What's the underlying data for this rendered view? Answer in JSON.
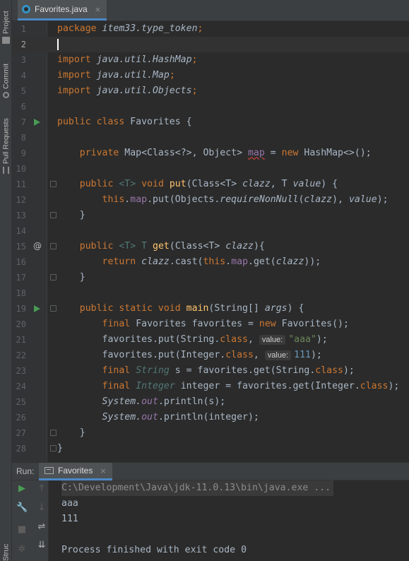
{
  "sidebar": {
    "tabs": [
      {
        "label": "Project",
        "icon": "folder-icon"
      },
      {
        "label": "Commit",
        "icon": "commit-icon"
      },
      {
        "label": "Pull Requests",
        "icon": "pull-request-icon"
      },
      {
        "label": "Structure",
        "icon": "structure-icon"
      }
    ]
  },
  "editor": {
    "tab_label": "Favorites.java",
    "close_glyph": "×",
    "current_line": 2,
    "lines": [
      {
        "n": "1"
      },
      {
        "n": "2"
      },
      {
        "n": "3"
      },
      {
        "n": "4"
      },
      {
        "n": "5"
      },
      {
        "n": "6"
      },
      {
        "n": "7"
      },
      {
        "n": "8"
      },
      {
        "n": "9"
      },
      {
        "n": "10"
      },
      {
        "n": "11"
      },
      {
        "n": "12"
      },
      {
        "n": "13"
      },
      {
        "n": "14"
      },
      {
        "n": "15"
      },
      {
        "n": "16"
      },
      {
        "n": "17"
      },
      {
        "n": "18"
      },
      {
        "n": "19"
      },
      {
        "n": "20"
      },
      {
        "n": "21"
      },
      {
        "n": "22"
      },
      {
        "n": "23"
      },
      {
        "n": "24"
      },
      {
        "n": "25"
      },
      {
        "n": "26"
      },
      {
        "n": "27"
      },
      {
        "n": "28"
      }
    ],
    "code": {
      "l1_kw": "package",
      "l1_pkg": "item33.type_token",
      "l1_end": ";",
      "import_kw": "import",
      "l3_pkg": "java.util.HashMap",
      "l4_pkg": "java.util.Map",
      "l5_pkg": "java.util.Objects",
      "semi": ";",
      "l7_kw": "public class",
      "l7_name": "Favorites",
      "l7_brace": " {",
      "l9_kw": "private",
      "l9_type": "Map<Class<?>, Object>",
      "l9_name": "map",
      "l9_eq": " = ",
      "l9_new": "new",
      "l9_rest": " HashMap<>();",
      "l11_kw": "public",
      "l11_generic": "<T>",
      "l11_void": "void",
      "l11_name": "put",
      "l11_params_a": "(Class<T> ",
      "l11_p1": "clazz",
      "l11_comma": ", T ",
      "l11_p2": "value",
      "l11_end": ") {",
      "l12_this": "this",
      "l12_a": ".",
      "l12_map": "map",
      "l12_b": ".put(Objects.",
      "l12_req": "requireNonNull",
      "l12_c": "(",
      "l12_clazz": "clazz",
      "l12_d": "), ",
      "l12_value": "value",
      "l12_e": ");",
      "close_brace": "}",
      "l15_kw": "public",
      "l15_generic": "<T>",
      "l15_t": "T",
      "l15_name": "get",
      "l15_a": "(Class<T> ",
      "l15_p": "clazz",
      "l15_b": "){",
      "l16_kw": "return",
      "l16_clazz": "clazz",
      "l16_a": ".cast(",
      "l16_this": "this",
      "l16_b": ".",
      "l16_map": "map",
      "l16_c": ".get(",
      "l16_p": "clazz",
      "l16_d": "));",
      "l19_kw": "public static void",
      "l19_name": "main",
      "l19_a": "(String[] ",
      "l19_p": "args",
      "l19_b": ") {",
      "final_kw": "final",
      "l20_type": "Favorites",
      "l20_a": " favorites = ",
      "l20_new": "new",
      "l20_b": " Favorites();",
      "l21_a": "favorites.put(String.",
      "class_kw": "class",
      "l21_b": ", ",
      "l21_hint": "value:",
      "l21_str": "\"aaa\"",
      "l21_c": ");",
      "l22_a": "favorites.put(Integer.",
      "l22_b": ", ",
      "l22_hint": "value:",
      "l22_num": "111",
      "l22_c": ");",
      "l23_type": "String",
      "l23_a": " s = favorites.get(String.",
      "l23_b": ");",
      "l24_type": "Integer",
      "l24_a": " integer = favorites.get(Integer.",
      "l24_b": ");",
      "l25_sys": "System.",
      "l25_out": "out",
      "l25_a": ".println(s);",
      "l26_sys": "System.",
      "l26_out": "out",
      "l26_a": ".println(integer);"
    }
  },
  "run_panel": {
    "title": "Run:",
    "tab_label": "Favorites",
    "close_glyph": "×",
    "console_lines": [
      "C:\\Development\\Java\\jdk-11.0.13\\bin\\java.exe ...",
      "aaa",
      "111",
      "",
      "Process finished with exit code 0"
    ]
  },
  "colors": {
    "keyword": "#cc7832",
    "string": "#6a8759",
    "number": "#6897bb",
    "field": "#9876aa",
    "run": "#499c54",
    "accent": "#4a88c7"
  }
}
